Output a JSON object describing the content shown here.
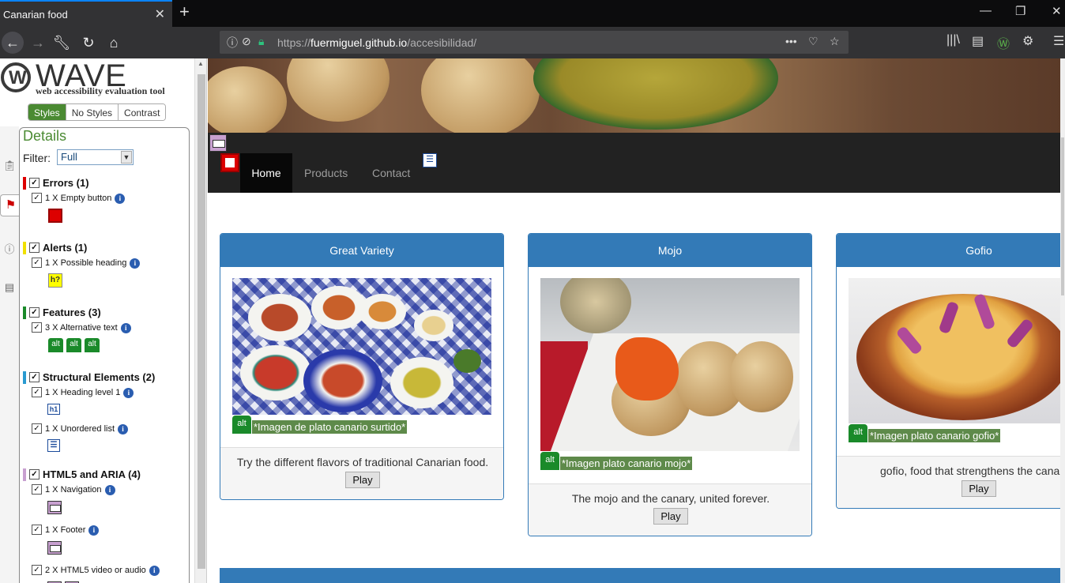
{
  "browser": {
    "tab_title": "Canarian food",
    "url_prefix": "https://",
    "url_host": "fuermiguel.github.io",
    "url_path": "/accesibilidad/"
  },
  "wave": {
    "title": "WAVE",
    "subtitle": "web accessibility evaluation tool",
    "style_tabs": [
      "Styles",
      "No Styles",
      "Contrast"
    ],
    "details_title": "Details",
    "filter_label": "Filter:",
    "filter_value": "Full",
    "categories": [
      {
        "label": "Errors (1)",
        "color": "#dd0000",
        "items": [
          {
            "label": "1 X Empty button"
          }
        ]
      },
      {
        "label": "Alerts (1)",
        "color": "#ffff00",
        "items": [
          {
            "label": "1 X Possible heading",
            "badge": "h?"
          }
        ]
      },
      {
        "label": "Features (3)",
        "color": "#1a8a2a",
        "items": [
          {
            "label": "3 X Alternative text",
            "badge": "alt"
          }
        ]
      },
      {
        "label": "Structural Elements (2)",
        "color": "#2a9ad0",
        "items": [
          {
            "label": "1 X Heading level 1",
            "badge": "h1"
          },
          {
            "label": "1 X Unordered list"
          }
        ]
      },
      {
        "label": "HTML5 and ARIA (4)",
        "color": "#c8a0d0",
        "items": [
          {
            "label": "1 X Navigation"
          },
          {
            "label": "1 X Footer"
          },
          {
            "label": "2 X HTML5 video or audio"
          }
        ]
      }
    ]
  },
  "page": {
    "nav": [
      "Home",
      "Products",
      "Contact"
    ],
    "cards": [
      {
        "title": "Great Variety",
        "alt_badge": "alt",
        "alt": "*Imagen de plato canario surtido*",
        "desc": "Try the different flavors of traditional Canarian food.",
        "button": "Play"
      },
      {
        "title": "Mojo",
        "alt_badge": "alt",
        "alt": "*Imagen plato canario mojo*",
        "desc": "The mojo and the canary, united forever.",
        "button": "Play"
      },
      {
        "title": "Gofio",
        "alt_badge": "alt",
        "alt": "*Imagen plato canario gofio*",
        "desc": "gofio, food that strengthens the cana",
        "button": "Play"
      }
    ]
  }
}
